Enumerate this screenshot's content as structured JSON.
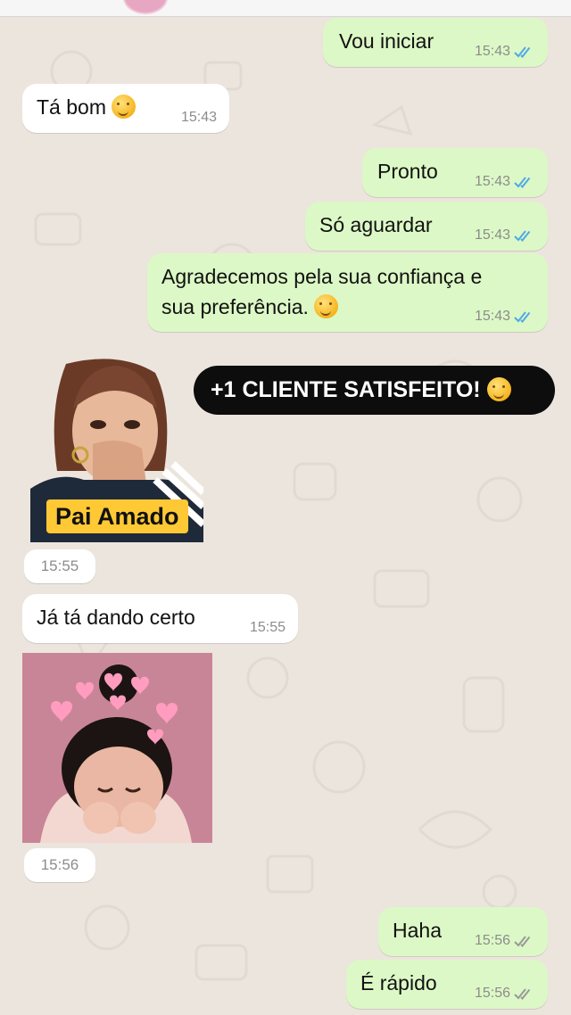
{
  "messages": [
    {
      "text": "Vou iniciar",
      "time": "15:43",
      "status": "read"
    },
    {
      "text": "Tá bom",
      "emoji": "shushing-face-emoji",
      "time": "15:43"
    },
    {
      "text": "Pronto",
      "time": "15:43",
      "status": "read"
    },
    {
      "text": "Só aguardar",
      "time": "15:43",
      "status": "read"
    },
    {
      "line1": "Agradecemos pela sua confiança e",
      "line2": "sua preferência.",
      "emoji": "star-struck-emoji",
      "time": "15:43",
      "status": "read"
    },
    {
      "banner": "+1 CLIENTE SATISFEITO!",
      "emoji": "star-struck-emoji"
    },
    {
      "sticker_caption": "Pai Amado",
      "time": "15:55",
      "sticker": "woman-hand-over-mouth-sticker"
    },
    {
      "text": "Já tá dando certo",
      "time": "15:55"
    },
    {
      "time": "15:56",
      "sticker": "girl-with-hearts-sticker"
    },
    {
      "text": "Haha",
      "time": "15:56",
      "status": "delivered"
    },
    {
      "text": "É rápido",
      "time": "15:56",
      "status": "delivered"
    }
  ],
  "colors": {
    "outgoing": "#dcf8c6",
    "incoming": "#ffffff",
    "wallpaper": "#ece5dd",
    "tick_read": "#4fa9e6",
    "tick_delivered": "#9a9a9a",
    "banner": "#0d0d0d"
  }
}
